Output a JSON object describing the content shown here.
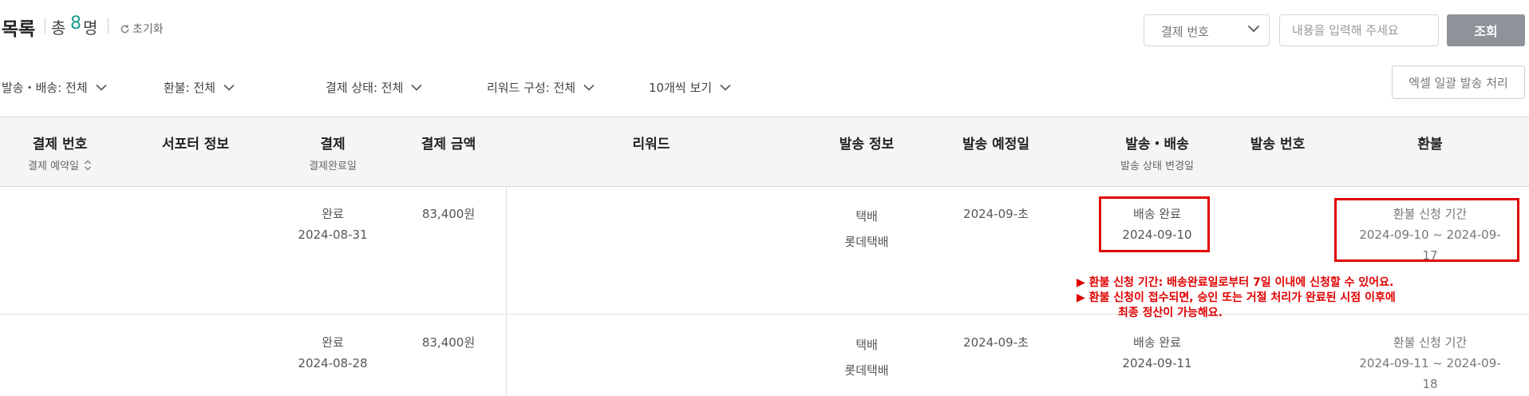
{
  "header": {
    "title": "목록",
    "total_label": "총",
    "total_count": "8",
    "total_unit": "명",
    "reset_label": "초기화"
  },
  "search": {
    "select_value": "결제 번호",
    "placeholder": "내용을 입력해 주세요",
    "button_label": "조회"
  },
  "filters": [
    "발송・배송: 전체",
    "환불: 전체",
    "결제 상태: 전체",
    "리워드 구성: 전체",
    "10개씩 보기"
  ],
  "excel_button": "엑셀 일괄 발송 처리",
  "columns": [
    {
      "title": "결제 번호",
      "sub": "결제 예약일"
    },
    {
      "title": "서포터 정보",
      "sub": ""
    },
    {
      "title": "결제",
      "sub": "결제완료일"
    },
    {
      "title": "결제 금액",
      "sub": ""
    },
    {
      "title": "리워드",
      "sub": ""
    },
    {
      "title": "발송 정보",
      "sub": ""
    },
    {
      "title": "발송 예정일",
      "sub": ""
    },
    {
      "title": "발송・배송",
      "sub": "발송 상태 변경일"
    },
    {
      "title": "발송 번호",
      "sub": ""
    },
    {
      "title": "환불",
      "sub": ""
    }
  ],
  "rows": [
    {
      "payment_status": "완료",
      "payment_date": "2024-08-31",
      "amount": "83,400원",
      "ship_method": "택배",
      "courier": "롯데택배",
      "ship_eta": "2024-09-초",
      "delivery_status": "배송 완료",
      "delivery_date": "2024-09-10",
      "refund_label": "환불 신청 기간",
      "refund_range_1": "2024-09-10 ~ 2024-09-",
      "refund_range_2": "17"
    },
    {
      "payment_status": "완료",
      "payment_date": "2024-08-28",
      "amount": "83,400원",
      "ship_method": "택배",
      "courier": "롯데택배",
      "ship_eta": "2024-09-초",
      "delivery_status": "배송 완료",
      "delivery_date": "2024-09-11",
      "refund_label": "환불 신청 기간",
      "refund_range_1": "2024-09-11 ~ 2024-09-",
      "refund_range_2": "18"
    }
  ],
  "notes": {
    "line1": "▶ 환불 신청 기간: 배송완료일로부터 7일 이내에 신청할 수 있어요.",
    "line2": "▶ 환불 신청이 접수되면, 승인 또는 거절 처리가 완료된 시점 이후에",
    "line3": "최종 정산이 가능해요."
  },
  "colors": {
    "accent": "#1a9e8f",
    "highlight": "#e00000",
    "button": "#8d9399"
  }
}
